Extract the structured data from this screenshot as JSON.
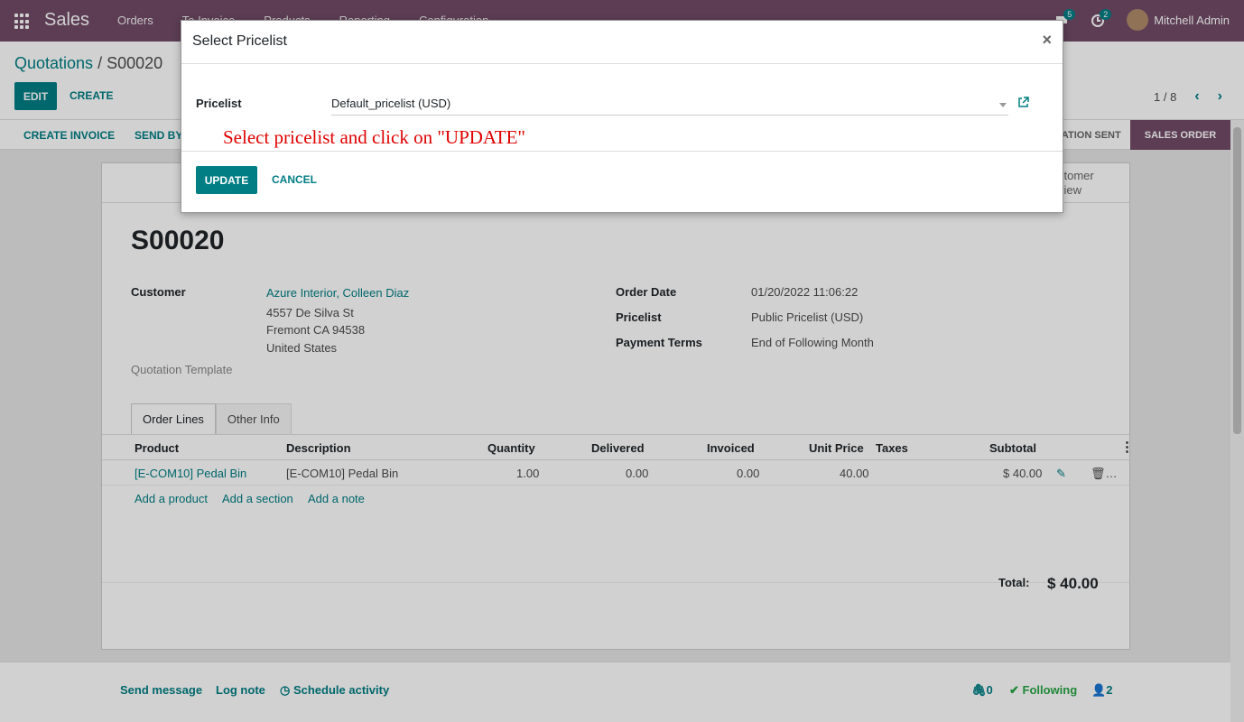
{
  "navbar": {
    "brand": "Sales",
    "menu": [
      "Orders",
      "To Invoice",
      "Products",
      "Reporting",
      "Configuration"
    ],
    "messages_count": "5",
    "activities_count": "2",
    "user": "Mitchell Admin"
  },
  "control": {
    "breadcrumb_parent": "Quotations",
    "breadcrumb_sep": " / ",
    "breadcrumb_current": "S00020",
    "edit_label": "EDIT",
    "create_label": "CREATE",
    "pager": "1 / 8"
  },
  "statusbar": {
    "create_invoice": "CREATE INVOICE",
    "send_by": "SEND BY",
    "stage_sent": "TATION SENT",
    "stage_sales_order": "SALES ORDER"
  },
  "sheet": {
    "smart_button": "stomer\nview",
    "title": "S00020",
    "customer_label": "Customer",
    "customer_name": "Azure Interior, Colleen Diaz",
    "address_line1": "4557 De Silva St",
    "address_line2": "Fremont CA 94538",
    "address_line3": "United States",
    "quotation_template_label": "Quotation Template",
    "order_date_label": "Order Date",
    "order_date": "01/20/2022 11:06:22",
    "pricelist_label": "Pricelist",
    "pricelist": "Public Pricelist (USD)",
    "payment_terms_label": "Payment Terms",
    "payment_terms": "End of Following Month",
    "tabs": [
      "Order Lines",
      "Other Info"
    ],
    "columns": [
      "Product",
      "Description",
      "Quantity",
      "Delivered",
      "Invoiced",
      "Unit Price",
      "Taxes",
      "Subtotal"
    ],
    "line": {
      "product": "[E-COM10] Pedal Bin",
      "description": "[E-COM10] Pedal Bin",
      "quantity": "1.00",
      "delivered": "0.00",
      "invoiced": "0.00",
      "unit_price": "40.00",
      "taxes": "",
      "subtotal": "$ 40.00"
    },
    "add_product": "Add a product",
    "add_section": "Add a section",
    "add_note": "Add a note",
    "total_label": "Total:",
    "total_value": "$ 40.00"
  },
  "chatter": {
    "send_message": "Send message",
    "log_note": "Log note",
    "schedule_activity": "Schedule activity",
    "attachments": "0",
    "following": "Following",
    "followers": "2"
  },
  "modal": {
    "title": "Select Pricelist",
    "close": "×",
    "pricelist_label": "Pricelist",
    "pricelist_value": "Default_pricelist (USD)",
    "hint": "Select pricelist and click on \"UPDATE\"",
    "update_label": "UPDATE",
    "cancel_label": "CANCEL"
  },
  "colors": {
    "brand": "#714b67",
    "accent": "#017e84",
    "hint": "#e00000"
  }
}
